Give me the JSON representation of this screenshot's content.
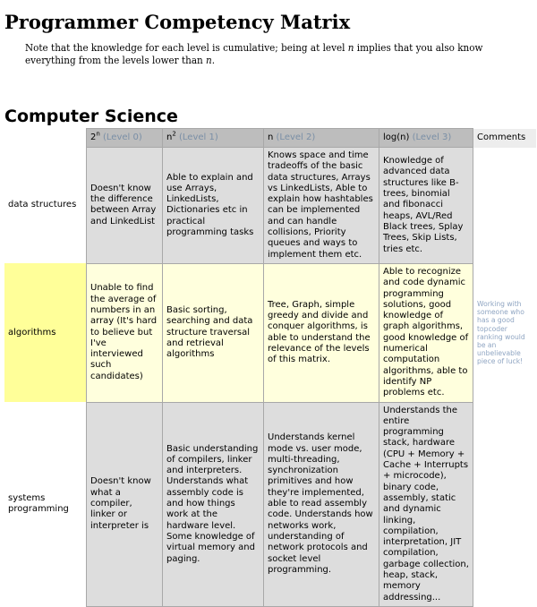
{
  "page": {
    "title": "Programmer Competency Matrix",
    "intro": {
      "before": "Note that the knowledge for each level is cumulative; being at level ",
      "var1": "n",
      "middle": " implies that you also know everything from the levels lower than ",
      "var2": "n",
      "after": "."
    }
  },
  "section": {
    "title": "Computer Science"
  },
  "matrix": {
    "headers": [
      {
        "base": "2",
        "sup": "n",
        "level": "(Level 0)"
      },
      {
        "base": "n",
        "sup": "2",
        "level": "(Level 1)"
      },
      {
        "base": "n",
        "sup": "",
        "level": "(Level 2)"
      },
      {
        "base": "log(n)",
        "sup": "",
        "level": "(Level 3)"
      }
    ],
    "comments_header": "Comments",
    "rows": [
      {
        "label": "data structures",
        "cells": [
          "Doesn't know the difference between Array and LinkedList",
          "Able to explain and use Arrays, LinkedLists, Dictionaries etc in practical programming tasks",
          "Knows space and time tradeoffs of the basic data structures, Arrays vs LinkedLists, Able to explain how hashtables can be implemented and can handle collisions, Priority queues and ways to implement them etc.",
          "Knowledge of advanced data structures like B-trees, binomial and fibonacci heaps, AVL/Red Black trees, Splay Trees, Skip Lists, tries etc."
        ],
        "comment": ""
      },
      {
        "label": "algorithms",
        "cells": [
          "Unable to find the average of numbers in an array (It's hard to believe but I've interviewed such candidates)",
          "Basic sorting, searching and data structure traversal and retrieval algorithms",
          "Tree, Graph, simple greedy and divide and conquer algorithms, is able to understand the relevance of the levels of this matrix.",
          "Able to recognize and code dynamic programming solutions, good knowledge of graph algorithms, good knowledge of numerical computation algorithms, able to identify NP problems etc."
        ],
        "comment": "Working with someone who has a good topcoder ranking would be an unbelievable piece of luck!"
      },
      {
        "label": "systems programming",
        "cells": [
          "Doesn't know what a compiler, linker or interpreter is",
          "Basic understanding of compilers, linker and interpreters. Understands what assembly code is and how things work at the hardware level. Some knowledge of virtual memory and paging.",
          "Understands kernel mode vs. user mode, multi-threading, synchronization primitives and how they're implemented, able to read assembly code. Understands how networks work, understanding of network protocols and socket level programming.",
          "Understands the entire programming stack, hardware (CPU + Memory + Cache + Interrupts + microcode), binary code, assembly, static and dynamic linking, compilation, interpretation, JIT compilation, garbage collection, heap, stack, memory addressing..."
        ],
        "comment": ""
      }
    ]
  },
  "colors": {
    "header_bg": "#bdbdbd",
    "level_tag": "#7a8fa6",
    "gray_row": "#dddddd",
    "yellow_row": "#ffffdd",
    "yellow_label": "#ffff99",
    "comment_text": "#8fa5c2"
  }
}
